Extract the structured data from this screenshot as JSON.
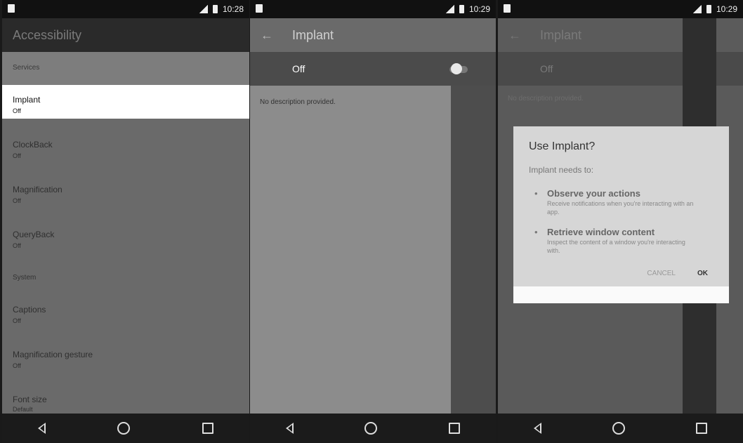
{
  "screen1": {
    "time": "10:28",
    "title": "Accessibility",
    "services_header": "Services",
    "items": [
      {
        "title": "Implant",
        "subtitle": "Off"
      },
      {
        "title": "ClockBack",
        "subtitle": "Off"
      },
      {
        "title": "Magnification",
        "subtitle": "Off"
      },
      {
        "title": "QueryBack",
        "subtitle": "Off"
      }
    ],
    "system_header": "System",
    "system_items": [
      {
        "title": "Captions",
        "subtitle": "Off"
      },
      {
        "title": "Magnification gesture",
        "subtitle": "Off"
      },
      {
        "title": "Font size",
        "subtitle": "Default"
      }
    ]
  },
  "screen2": {
    "time": "10:29",
    "title": "Implant",
    "switch_label": "Off",
    "description": "No description provided."
  },
  "screen3": {
    "time": "10:29",
    "bg_title": "Implant",
    "bg_switch": "Off",
    "bg_desc": "No description provided.",
    "dialog": {
      "title": "Use Implant?",
      "subtitle": "Implant needs to:",
      "permissions": [
        {
          "title": "Observe your actions",
          "desc": "Receive notifications when you're interacting with an app."
        },
        {
          "title": "Retrieve window content",
          "desc": "Inspect the content of a window you're interacting with."
        }
      ],
      "cancel": "CANCEL",
      "ok": "OK"
    }
  }
}
